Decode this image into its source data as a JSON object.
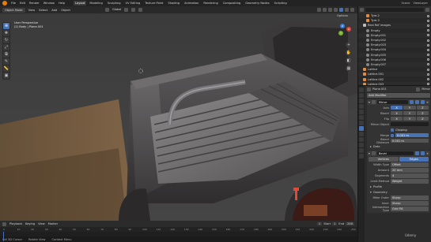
{
  "topbar": {
    "menus": [
      "File",
      "Edit",
      "Render",
      "Window",
      "Help"
    ],
    "workspaces": [
      "Layout",
      "Modeling",
      "Sculpting",
      "UV Editing",
      "Texture Paint",
      "Shading",
      "Animation",
      "Rendering",
      "Compositing",
      "Geometry Nodes",
      "Scripting"
    ],
    "active_workspace": "Layout",
    "scene": "Scene",
    "view_layer": "ViewLayer"
  },
  "viewport": {
    "mode": "Object Mode",
    "menus": [
      "View",
      "Select",
      "Add",
      "Object"
    ],
    "orientation": "Global",
    "options": "Options",
    "info_line1": "User Perspective",
    "info_line2": "(2) Body | Plane.001",
    "gizmo_labels": {
      "x": "X",
      "y": "Y",
      "z": "Z"
    }
  },
  "toolbar": {
    "tools": [
      "cursor",
      "move",
      "rotate",
      "scale",
      "transform",
      "annotate",
      "measure",
      "add-cube"
    ]
  },
  "timeline": {
    "menus": [
      "Playback",
      "Keying",
      "View",
      "Marker"
    ],
    "current_frame": "1",
    "start_label": "Start",
    "start": "1",
    "end_label": "End",
    "end": "250",
    "ruler": [
      "0",
      "10",
      "20",
      "30",
      "40",
      "50",
      "60",
      "70",
      "80",
      "90",
      "100",
      "110",
      "120",
      "130",
      "140",
      "150",
      "160",
      "170",
      "180",
      "190",
      "200",
      "210",
      "220",
      "230",
      "240",
      "250"
    ],
    "status": [
      "Set 3D Cursor",
      "Rotate View",
      "Context Menu"
    ]
  },
  "outliner": {
    "rows": [
      {
        "label": "Tyre.2",
        "type": "obj",
        "indent": 2
      },
      {
        "label": "Tyre.3",
        "type": "obj",
        "indent": 2
      },
      {
        "label": "Real Ref images",
        "type": "coll",
        "indent": 1
      },
      {
        "label": "Empty",
        "type": "empty",
        "indent": 2
      },
      {
        "label": "Empty.001",
        "type": "empty",
        "indent": 2
      },
      {
        "label": "Empty.002",
        "type": "empty",
        "indent": 2
      },
      {
        "label": "Empty.003",
        "type": "empty",
        "indent": 2
      },
      {
        "label": "Empty.004",
        "type": "empty",
        "indent": 2
      },
      {
        "label": "Empty.005",
        "type": "empty",
        "indent": 2
      },
      {
        "label": "Empty.006",
        "type": "empty",
        "indent": 2
      },
      {
        "label": "Empty.007",
        "type": "empty",
        "indent": 2
      },
      {
        "label": "Lattice",
        "type": "obj",
        "indent": 1
      },
      {
        "label": "Lattice.001",
        "type": "obj",
        "indent": 1
      },
      {
        "label": "Lattice.002",
        "type": "obj",
        "indent": 1
      },
      {
        "label": "Lattice.003",
        "type": "obj",
        "indent": 1
      },
      {
        "label": "Lattice.004",
        "type": "obj",
        "indent": 1
      }
    ]
  },
  "properties": {
    "object_name": "Plane.001",
    "modifier_label": "Mirror",
    "add_modifier": "Add Modifier",
    "mirror": {
      "name": "Mirror",
      "axis_label": "Axis",
      "bisect_label": "Bisect",
      "flip_label": "Flip",
      "axes": [
        "X",
        "Y",
        "Z"
      ],
      "mirror_object_label": "Mirror Object",
      "clipping_label": "Clipping",
      "merge_label": "Merge",
      "merge_value": "0.001 m",
      "bisect_distance_label": "Bisect Distance",
      "bisect_distance_value": "0.001 m",
      "data_label": "Data"
    },
    "bevel": {
      "name": "Bevel",
      "tabs": [
        "Vertices",
        "Edges"
      ],
      "width_type_label": "Width Type",
      "width_type": "Offset",
      "amount_label": "Amount",
      "amount": "20 mm",
      "segments_label": "Segments",
      "segments": "4",
      "limit_method_label": "Limit Method",
      "limit_method": "Weight",
      "profile_label": "Profile",
      "geometry_label": "Geometry",
      "miter_outer_label": "Miter Outer",
      "miter_outer": "Sharp",
      "inner_label": "Inner",
      "inner": "Sharp",
      "intersection_label": "Intersection Type",
      "intersection": "Grid Fill"
    }
  },
  "watermark": "Udemy"
}
